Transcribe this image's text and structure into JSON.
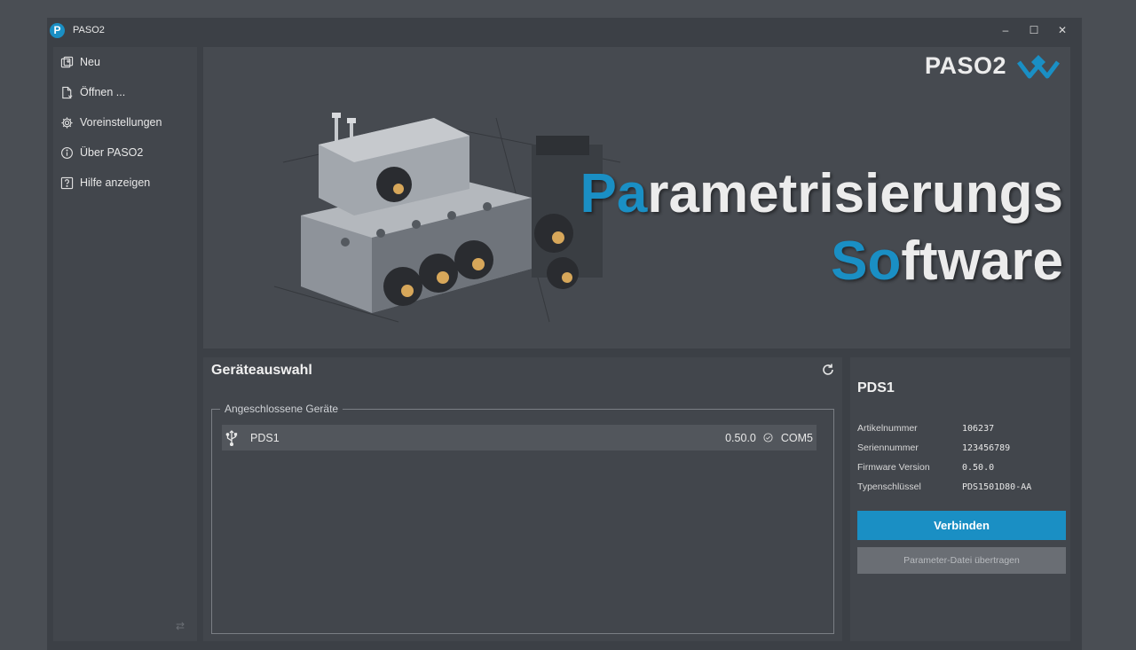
{
  "window": {
    "title": "PASO2",
    "app_icon_letter": "P",
    "controls": {
      "minimize": "–",
      "maximize": "☐",
      "close": "✕"
    }
  },
  "sidebar": {
    "items": [
      {
        "label": "Neu",
        "icon": "new-file-icon"
      },
      {
        "label": "Öffnen ...",
        "icon": "open-file-icon"
      },
      {
        "label": "Voreinstellungen",
        "icon": "gear-icon"
      },
      {
        "label": "Über PASO2",
        "icon": "info-icon"
      },
      {
        "label": "Hilfe anzeigen",
        "icon": "help-icon"
      }
    ],
    "footer_glyph": "⇄"
  },
  "banner": {
    "brand": "PASO2",
    "headline_line1_accent": "Pa",
    "headline_line1_rest": "rametrisierungs",
    "headline_line2_accent": "So",
    "headline_line2_rest": "ftware"
  },
  "devices": {
    "title": "Geräteauswahl",
    "group_label": "Angeschlossene Geräte",
    "rows": [
      {
        "name": "PDS1",
        "version": "0.50.0",
        "port": "COM5"
      }
    ]
  },
  "detail": {
    "title": "PDS1",
    "fields": [
      {
        "label": "Artikelnummer",
        "value": "106237"
      },
      {
        "label": "Seriennummer",
        "value": "123456789"
      },
      {
        "label": "Firmware Version",
        "value": "0.50.0"
      },
      {
        "label": "Typenschlüssel",
        "value": "PDS1501D80-AA"
      }
    ],
    "connect_label": "Verbinden",
    "transfer_label": "Parameter-Datei übertragen"
  },
  "colors": {
    "accent": "#1a8fc4",
    "background": "#3c4046",
    "panel": "#42464c",
    "disabled_button": "#6a6e74"
  }
}
